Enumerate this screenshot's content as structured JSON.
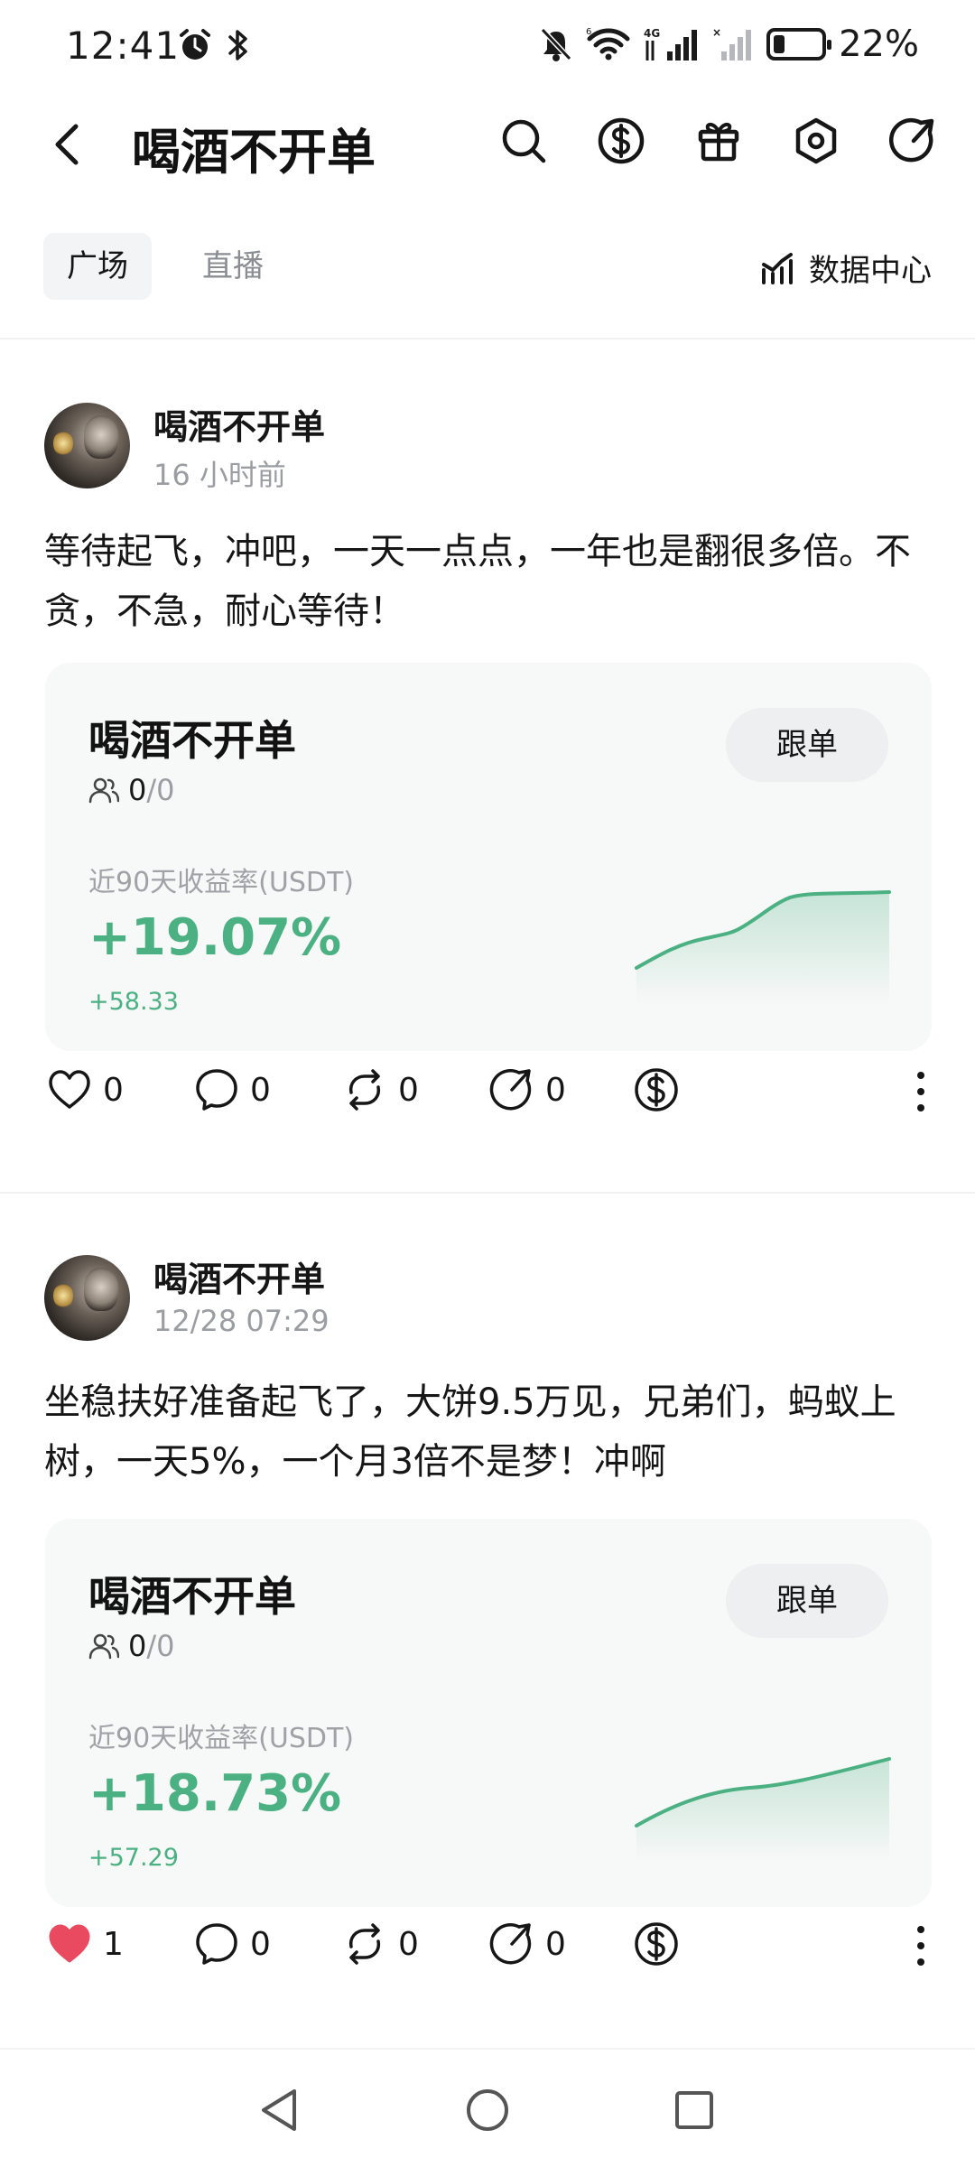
{
  "status_bar": {
    "time": "12:41",
    "battery": "22%",
    "icons": [
      "alarm-icon",
      "bluetooth-icon",
      "mute-icon",
      "wifi-icon",
      "signal-4g-icon",
      "signal-nosim-icon",
      "battery-icon"
    ]
  },
  "header": {
    "title": "喝酒不开单",
    "icons": [
      "back-icon",
      "search-icon",
      "dollar-icon",
      "gift-icon",
      "settings-icon",
      "share-icon"
    ]
  },
  "tabs": {
    "items": [
      {
        "label": "广场",
        "active": true
      },
      {
        "label": "直播",
        "active": false
      }
    ],
    "data_center": "数据中心"
  },
  "posts": [
    {
      "author": "喝酒不开单",
      "time": "16 小时前",
      "content": "等待起飞，冲吧，一天一点点，一年也是翻很多倍。不贪，不急，耐心等待！",
      "card": {
        "name": "喝酒不开单",
        "followers": "0",
        "followers_cap": "/0",
        "follow_button": "跟单",
        "label": "近90天收益率(USDT)",
        "rate": "+19.07%",
        "amount": "+58.33"
      },
      "actions": {
        "likes": "0",
        "comments": "0",
        "reposts": "0",
        "shares": "0",
        "liked": false
      }
    },
    {
      "author": "喝酒不开单",
      "time": "12/28 07:29",
      "content": "坐稳扶好准备起飞了，大饼9.5万见，兄弟们，蚂蚁上树，一天5%，一个月3倍不是梦！冲啊",
      "card": {
        "name": "喝酒不开单",
        "followers": "0",
        "followers_cap": "/0",
        "follow_button": "跟单",
        "label": "近90天收益率(USDT)",
        "rate": "+18.73%",
        "amount": "+57.29"
      },
      "actions": {
        "likes": "1",
        "comments": "0",
        "reposts": "0",
        "shares": "0",
        "liked": true
      }
    }
  ],
  "colors": {
    "profit_green": "#4bb183",
    "like_red": "#ea4a5f",
    "card_bg": "#f7f8f8"
  },
  "nav_bar": {
    "buttons": [
      "back-triangle-icon",
      "home-circle-icon",
      "recents-square-icon"
    ]
  }
}
